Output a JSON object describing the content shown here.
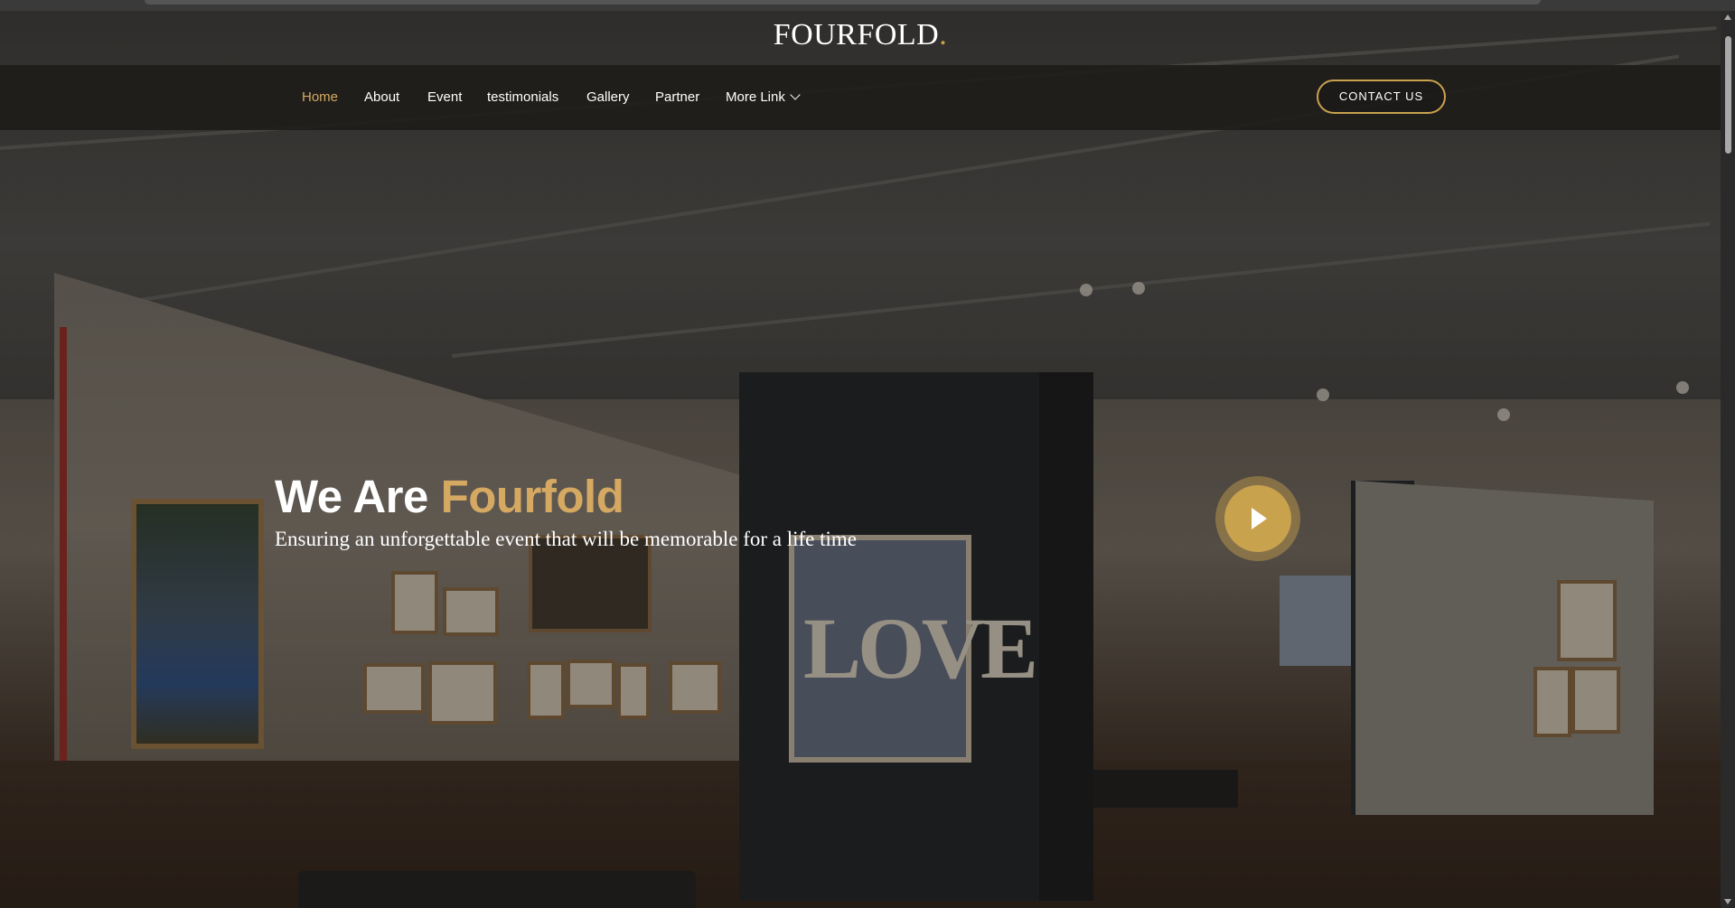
{
  "brand": {
    "name": "FOURFOLD",
    "dot": "."
  },
  "nav": {
    "items": [
      {
        "label": "Home",
        "active": true
      },
      {
        "label": "About"
      },
      {
        "label": "Event"
      },
      {
        "label": "testimonials"
      },
      {
        "label": "Gallery"
      },
      {
        "label": "Partner"
      },
      {
        "label": "More Link",
        "icon": "chevron-down-icon"
      }
    ],
    "contact_label": "CONTACT US"
  },
  "hero": {
    "title_prefix": "We Are",
    "title_accent": "Fourfold",
    "subtitle": "Ensuring an unforgettable event that will be memorable for a life time",
    "play_icon": "play-icon"
  },
  "artwork": {
    "love_text": "LOVE"
  },
  "colors": {
    "accent": "#c9a24e",
    "active_nav": "#d6a962",
    "nav_bg": "#1e1b18"
  }
}
